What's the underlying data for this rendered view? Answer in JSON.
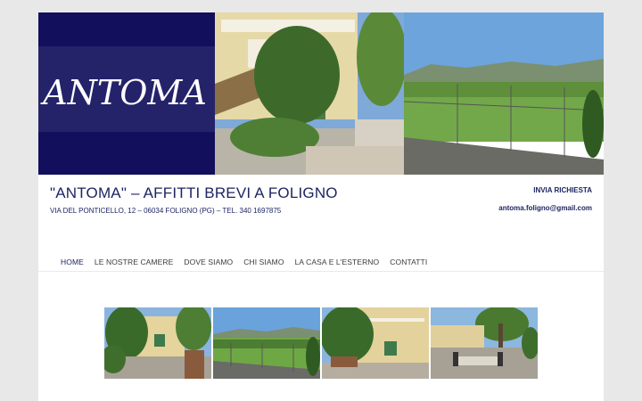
{
  "header": {
    "logo_text": "ANTOMA",
    "site_title": "\"ANTOMA\" – AFFITTI BREVI A FOLIGNO",
    "site_description": "VIA DEL PONTICELLO, 12 – 06034 FOLIGNO (PG) – TEL. 340 1697875",
    "request_link": "INVIA RICHIESTA",
    "email": "antoma.foligno@gmail.com"
  },
  "nav": {
    "items": [
      {
        "label": "HOME",
        "active": true
      },
      {
        "label": "LE NOSTRE CAMERE",
        "active": false
      },
      {
        "label": "DOVE SIAMO",
        "active": false
      },
      {
        "label": "CHI SIAMO",
        "active": false
      },
      {
        "label": "LA CASA E L'ESTERNO",
        "active": false
      },
      {
        "label": "CONTATTI",
        "active": false
      }
    ]
  },
  "colors": {
    "brand_navy": "#1d2562",
    "logo_dark": "#120f5c",
    "logo_band": "#24236a"
  },
  "gallery": {
    "images": [
      "house-garden-photo",
      "fenced-field-photo",
      "house-terrace-photo",
      "patio-table-photo"
    ]
  }
}
